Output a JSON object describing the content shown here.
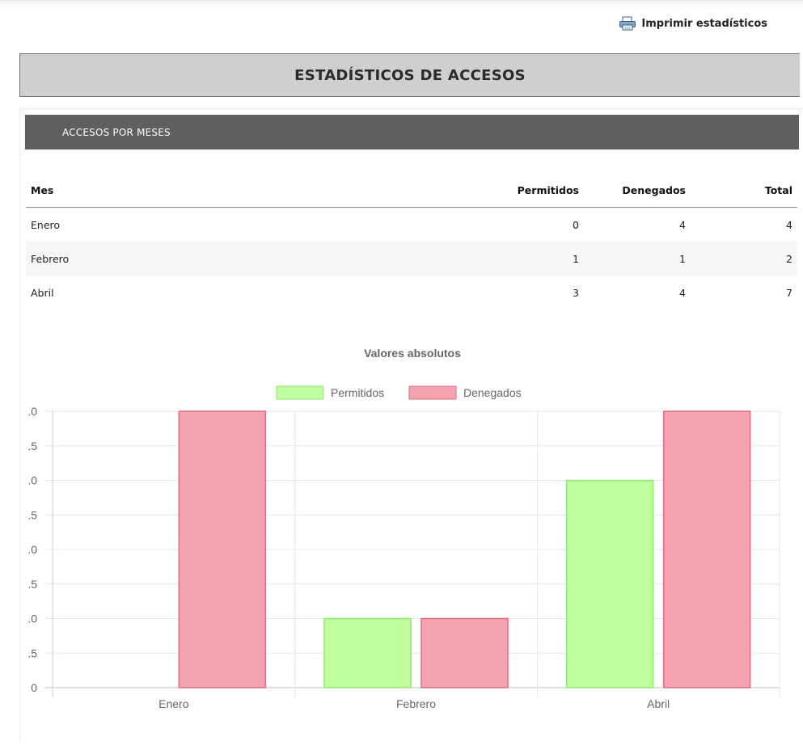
{
  "print": {
    "label": "Imprimir estadísticos",
    "icon": "printer-icon"
  },
  "header": {
    "title": "ESTADÍSTICOS DE ACCESOS"
  },
  "section": {
    "title": "ACCESOS POR MESES"
  },
  "table": {
    "columns": [
      "Mes",
      "Permitidos",
      "Denegados",
      "Total"
    ],
    "rows": [
      [
        "Enero",
        "0",
        "4",
        "4"
      ],
      [
        "Febrero",
        "1",
        "1",
        "2"
      ],
      [
        "Abril",
        "3",
        "4",
        "7"
      ]
    ]
  },
  "colors": {
    "permitidos_fill": "#bfffa0",
    "permitidos_stroke": "#8fe66e",
    "denegados_fill": "#f5a3b0",
    "denegados_stroke": "#e56a7d",
    "section_bar": "#5f5f5f",
    "header_bg": "#cfcfcf"
  },
  "chart_data": {
    "type": "bar",
    "title": "Valores absolutos",
    "categories": [
      "Enero",
      "Febrero",
      "Abril"
    ],
    "series": [
      {
        "name": "Permitidos",
        "values": [
          0,
          1,
          3
        ]
      },
      {
        "name": "Denegados",
        "values": [
          4,
          1,
          4
        ]
      }
    ],
    "y_ticks": [
      ".0",
      ".5",
      ".0",
      ".5",
      ".0",
      ".5",
      ".0",
      ".5",
      "0"
    ],
    "ylim": [
      0,
      4
    ],
    "legend": "top",
    "grid": true
  }
}
